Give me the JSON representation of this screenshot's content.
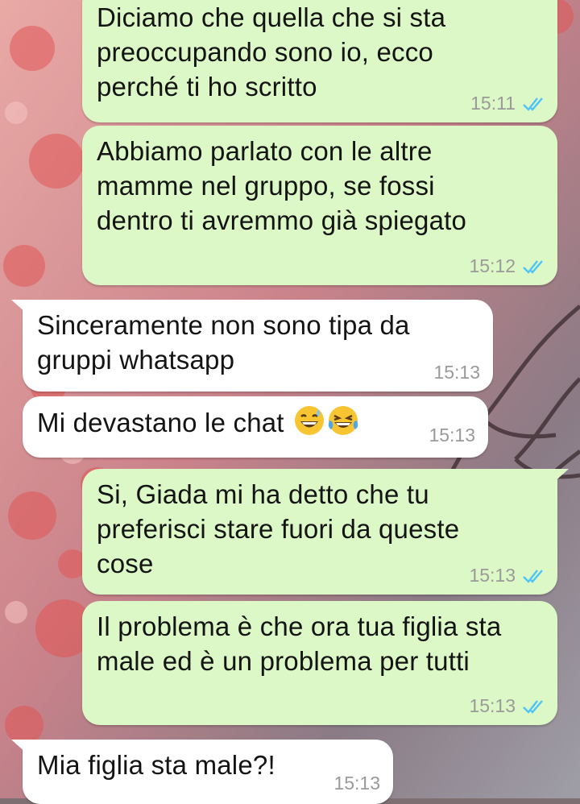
{
  "colors": {
    "outgoing_bubble": "#dcf8c6",
    "incoming_bubble": "#ffffff",
    "read_ticks": "#4fc3f7",
    "timestamp": "#9a9a9a"
  },
  "messages": [
    {
      "direction": "outgoing",
      "text": "Diciamo che quella che si sta\npreoccupando sono io, ecco\nperché ti ho scritto",
      "time": "15:11",
      "status_icon": "double-check-read-icon"
    },
    {
      "direction": "outgoing",
      "text": "Abbiamo parlato con le altre\nmamme nel gruppo, se fossi\ndentro ti avremmo già spiegato",
      "time": "15:12",
      "status_icon": "double-check-read-icon"
    },
    {
      "direction": "incoming",
      "text": "Sinceramente non sono tipa da\ngruppi whatsapp",
      "time": "15:13"
    },
    {
      "direction": "incoming",
      "text": "Mi devastano le chat",
      "time": "15:13",
      "emojis": [
        "grinning-sweat-emoji",
        "tears-of-joy-emoji"
      ]
    },
    {
      "direction": "outgoing",
      "text": "Si, Giada mi ha detto che tu\npreferisci stare fuori da queste\ncose",
      "time": "15:13",
      "status_icon": "double-check-read-icon"
    },
    {
      "direction": "outgoing",
      "text": "Il problema è che ora tua figlia sta\nmale ed è un problema per tutti",
      "time": "15:13",
      "status_icon": "double-check-read-icon"
    },
    {
      "direction": "incoming",
      "text": "Mia figlia sta male?!",
      "time": "15:13"
    }
  ]
}
